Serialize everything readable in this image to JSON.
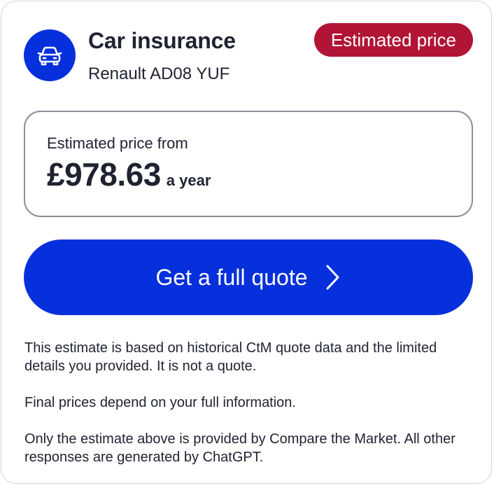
{
  "header": {
    "title": "Car insurance",
    "vehicle": "Renault AD08 YUF",
    "badge": "Estimated price",
    "icon": "car-icon"
  },
  "price": {
    "label": "Estimated price from",
    "amount": "£978.63",
    "unit": "a year"
  },
  "cta": {
    "label": "Get a full quote",
    "icon": "chevron-right-icon"
  },
  "disclaimer": {
    "p1": "This estimate is based on historical CtM quote data and the limited details you provided. It is not a quote.",
    "p2": "Final prices depend on your full information.",
    "p3": "Only the estimate above is provided by Compare the Market. All other responses are generated by ChatGPT."
  },
  "colors": {
    "brand_blue": "#0530dc",
    "badge_red": "#b11434",
    "text": "#1f2331",
    "border": "#8e8e9a"
  }
}
